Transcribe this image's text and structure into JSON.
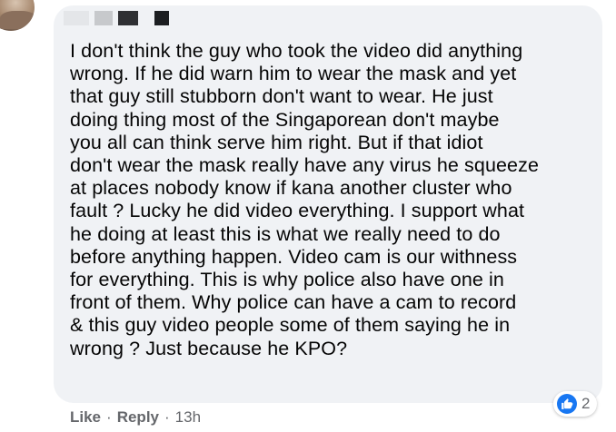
{
  "comment": {
    "text": "I don't think the guy who took the video did anything\nwrong. If he did warn him to wear the mask and yet\nthat guy still stubborn don't want to wear. He just\ndoing thing most of the Singaporean don't maybe\nyou all can think serve him right. But if that idiot\ndon't wear the mask really have any virus he squeeze\nat places nobody know if kana another cluster who\nfault ? Lucky he did video everything. I support what\nhe doing at least this is what we really need to do\nbefore anything happen. Video cam is our withness\nfor everything. This is why police also have one in\nfront of them. Why police can have a cam to record\n& this guy video people some of them saying he in\nwrong ? Just because he KPO?"
  },
  "reactions": {
    "icon": "like-icon",
    "count": "2",
    "color": "#1877f2"
  },
  "actions": {
    "like_label": "Like",
    "separator": "·",
    "reply_label": "Reply",
    "timestamp": "13h"
  }
}
